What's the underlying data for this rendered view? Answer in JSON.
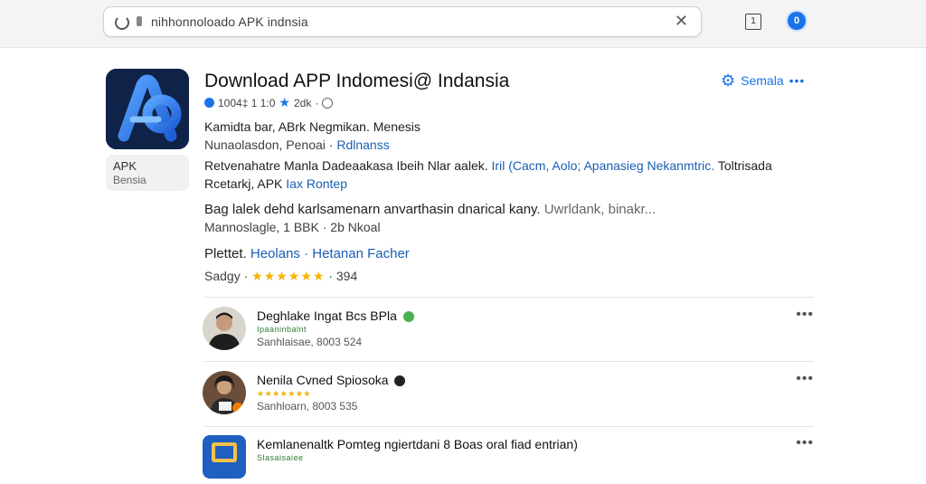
{
  "browser": {
    "url": "nihhonnoloado APK indnsia",
    "tab_count": "1",
    "profile_initial": "0"
  },
  "app": {
    "title": "Download APP Indomesi@ Indansia",
    "meta": {
      "downloads": "1004‡ 1 1:0",
      "rating": "2dk"
    },
    "badge": {
      "line1": "APK",
      "line2": "Bensia"
    },
    "share_label": "Semala",
    "line1": "Kamidta bar, ABrk  Negmikan.  Menesis",
    "line2_prefix": "Nunaolasdon, Penoai  ·",
    "line2_link": "Rdlnanss",
    "desc1_prefix": "Retvenahatre Manla Dadeaakasa Ibeih Nlar aalek.",
    "desc1_link": "Iril (Cacm, Aolo; Apanasieg Nekanmtric.",
    "desc1_suffix": "Toltrisada",
    "desc2_prefix": "Rcetarkj, APK",
    "desc2_link": "Iax Rontep",
    "info_main": "Bag lalek dehd karlsamenarn anvarthasin dnarical kany.",
    "info_grey": "Uwrldank, binakr...",
    "info_sub": "Mannoslagle, 1 BBK · 2b Nkoal",
    "platform_label": "Plettet.",
    "platform_link": "Heolans · Hetanan Facher",
    "rating_label": "Sadgy ·",
    "rating_stars": "★★★★★★",
    "rating_count": "· 394"
  },
  "related": [
    {
      "title": "Deghlake Ingat Bcs BPla",
      "tag": "Ipaaninbalnt",
      "meta": "Sanhlaisae, 8003 524",
      "dot_color": "#4caf50"
    },
    {
      "title": "Nenila Cvned Spiosoka",
      "tag": "★★★★★★★",
      "meta": "Sanhloarn, 8003 535",
      "dot_color": "#222222"
    },
    {
      "title": "Kemlanenaltk Pomteg ngiertdani 8 Boas oral fiad entrian)",
      "tag": "Slasaisaiee",
      "meta": "",
      "dot_color": ""
    }
  ],
  "colors": {
    "accent": "#1a73e8",
    "link": "#1a5fb4",
    "star": "#f4b400",
    "logo_bg": "#0f2247"
  },
  "icons": [
    "reload-icon",
    "lock-icon",
    "clear-icon",
    "tabs-icon",
    "profile-icon",
    "gear-icon",
    "star-icon",
    "globe-icon",
    "more-icon"
  ]
}
